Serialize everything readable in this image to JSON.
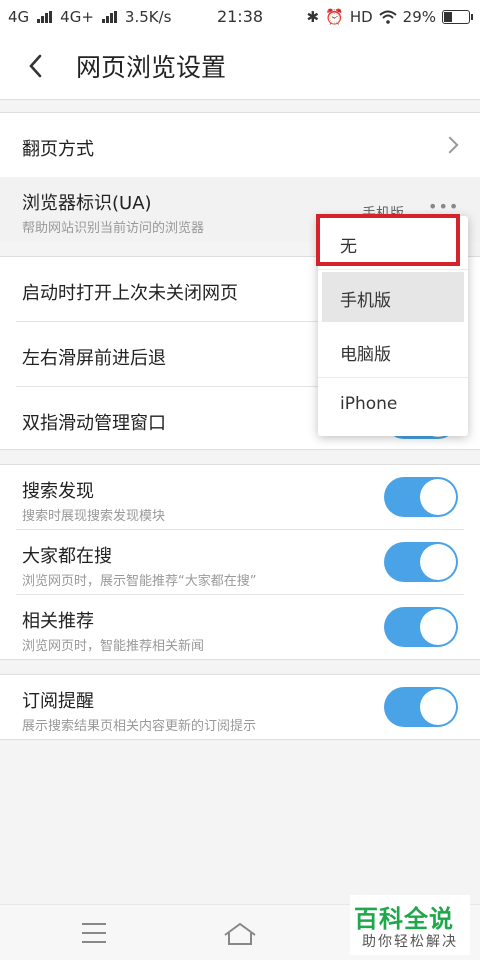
{
  "status_bar": {
    "sim1": "4G",
    "sim2": "4G+",
    "speed": "3.5K/s",
    "time": "21:38",
    "hd": "HD",
    "battery": "29%",
    "battery_level": 0.29
  },
  "header": {
    "title": "网页浏览设置"
  },
  "settings": {
    "page_turn": {
      "label": "翻页方式"
    },
    "ua": {
      "label": "浏览器标识(UA)",
      "desc": "帮助网站识别当前访问的浏览器",
      "value": "手机版"
    },
    "open_last": {
      "label": "启动时打开上次未关闭网页"
    },
    "swipe": {
      "label": "左右滑屏前进后退"
    },
    "two_finger": {
      "label": "双指滑动管理窗口"
    },
    "search_discover": {
      "label": "搜索发现",
      "desc": "搜索时展现搜索发现模块",
      "on": true
    },
    "everyone_search": {
      "label": "大家都在搜",
      "desc": "浏览网页时，展示智能推荐“大家都在搜”",
      "on": true
    },
    "related": {
      "label": "相关推荐",
      "desc": "浏览网页时，智能推荐相关新闻",
      "on": true
    },
    "subscribe": {
      "label": "订阅提醒",
      "desc": "展示搜索结果页相关内容更新的订阅提示",
      "on": true
    }
  },
  "ua_dropdown": {
    "options": [
      "无",
      "手机版",
      "电脑版",
      "iPhone"
    ],
    "selected": "手机版"
  },
  "watermark": {
    "title": "百科全说",
    "subtitle": "助你轻松解决"
  },
  "colors": {
    "toggle_on": "#4aa3e6",
    "highlight": "#d4232b",
    "watermark": "#1ea84a"
  }
}
